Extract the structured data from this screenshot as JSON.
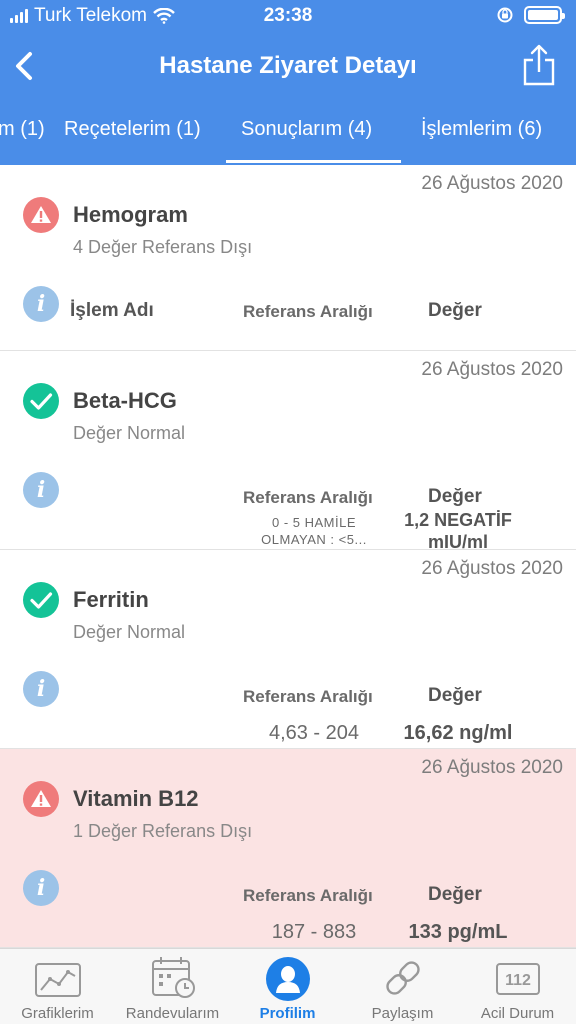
{
  "status_bar": {
    "carrier": "Turk Telekom",
    "time": "23:38"
  },
  "header": {
    "title": "Hastane Ziyaret Detayı",
    "back_icon": "chevron-left-icon",
    "share_icon": "share-icon"
  },
  "tabs": [
    {
      "label": "m (1)"
    },
    {
      "label": "Reçetelerim (1)"
    },
    {
      "label": "Sonuçlarım (4)",
      "active": true
    },
    {
      "label": "İşlemlerim (6)"
    }
  ],
  "results": [
    {
      "date": "26 Ağustos 2020",
      "name": "Hemogram",
      "status": "4 Değer Referans Dışı",
      "status_type": "warning",
      "col_name": "İşlem Adı",
      "col_ref": "Referans Aralığı",
      "col_val": "Değer"
    },
    {
      "date": "26 Ağustos 2020",
      "name": "Beta-HCG",
      "status": "Değer Normal",
      "status_type": "normal",
      "col_ref": "Referans Aralığı",
      "col_val": "Değer",
      "ref_line1": "0 - 5 HAMİLE",
      "ref_line2": "OLMAYAN : <5...",
      "value_line1": "1,2 NEGATİF",
      "value_line2": "mIU/ml"
    },
    {
      "date": "26 Ağustos 2020",
      "name": "Ferritin",
      "status": "Değer Normal",
      "status_type": "normal",
      "col_ref": "Referans Aralığı",
      "col_val": "Değer",
      "ref_range": "4,63 - 204",
      "value": "16,62 ng/ml"
    },
    {
      "date": "26 Ağustos 2020",
      "name": "Vitamin  B12",
      "status": "1 Değer Referans Dışı",
      "status_type": "warning",
      "col_ref": "Referans Aralığı",
      "col_val": "Değer",
      "ref_range": "187 - 883",
      "value": "133 pg/mL"
    }
  ],
  "tab_bar": [
    {
      "label": "Grafiklerim",
      "icon": "chart-icon"
    },
    {
      "label": "Randevularım",
      "icon": "calendar-icon"
    },
    {
      "label": "Profilim",
      "icon": "profile-icon",
      "active": true
    },
    {
      "label": "Paylaşım",
      "icon": "link-icon"
    },
    {
      "label": "Acil Durum",
      "icon": "emergency-112-icon",
      "badge": "112"
    }
  ],
  "colors": {
    "header_bg": "#4a8de8",
    "alert_row_bg": "#fbe3e3",
    "warning": "#ef7b7b",
    "ok": "#14c397",
    "info": "#9cc3e8",
    "active_tab": "#1e7fe6"
  }
}
